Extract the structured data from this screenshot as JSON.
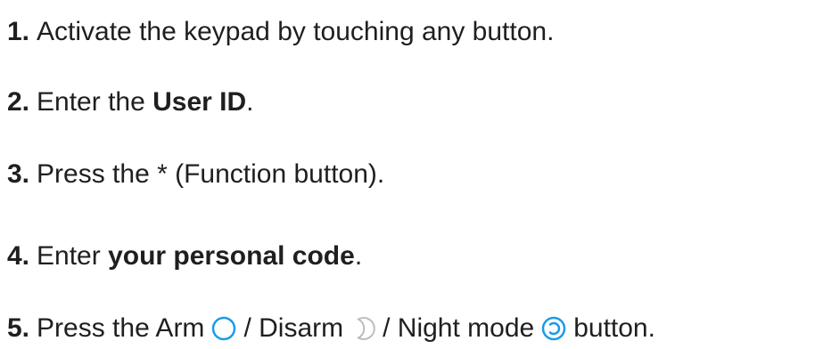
{
  "colors": {
    "text": "#1f1f1f",
    "accent_blue": "#1a9be8",
    "disarm_gray": "#bcbcbc"
  },
  "steps": [
    {
      "number": "1.",
      "text": "Activate the keypad by touching any button."
    },
    {
      "number": "2.",
      "prefix": "Enter the ",
      "bold": "User ID",
      "suffix": "."
    },
    {
      "number": "3.",
      "text": "Press the * (Function button)."
    },
    {
      "number": "4.",
      "prefix": "Enter ",
      "bold": "your personal code",
      "suffix": "."
    },
    {
      "number": "5.",
      "part1": "Press the Arm",
      "part2": "/ Disarm",
      "part3": "/ Night mode",
      "part4": "button.",
      "icons": [
        "arm-icon",
        "disarm-icon",
        "night-mode-icon"
      ]
    }
  ]
}
